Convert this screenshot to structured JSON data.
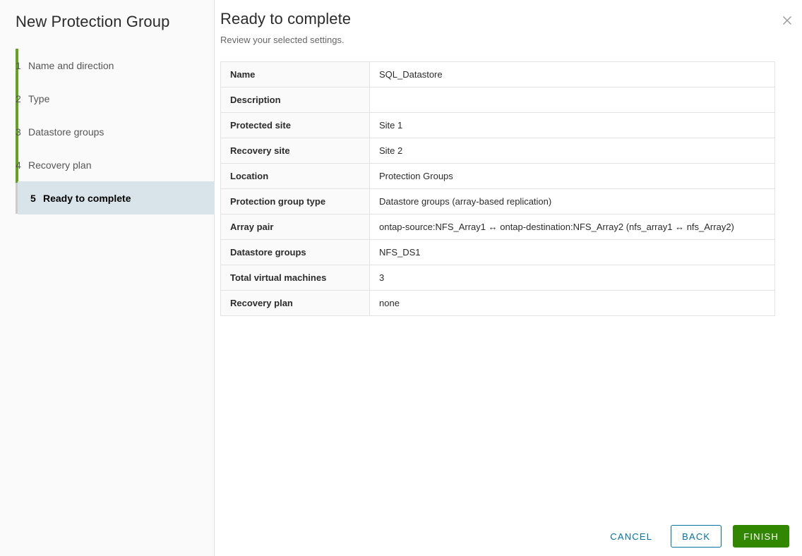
{
  "wizard": {
    "title": "New Protection Group",
    "steps": [
      {
        "number": "1",
        "label": "Name and direction"
      },
      {
        "number": "2",
        "label": "Type"
      },
      {
        "number": "3",
        "label": "Datastore groups"
      },
      {
        "number": "4",
        "label": "Recovery plan"
      },
      {
        "number": "5",
        "label": "Ready to complete"
      }
    ],
    "selected_step_index": 4
  },
  "content": {
    "title": "Ready to complete",
    "subtitle": "Review your selected settings.",
    "close_icon": "close-icon"
  },
  "summary": {
    "rows": [
      {
        "key": "Name",
        "value": "SQL_Datastore"
      },
      {
        "key": "Description",
        "value": ""
      },
      {
        "key": "Protected site",
        "value": "Site 1"
      },
      {
        "key": "Recovery site",
        "value": "Site 2"
      },
      {
        "key": "Location",
        "value": "Protection Groups"
      },
      {
        "key": "Protection group type",
        "value": "Datastore groups (array-based replication)"
      },
      {
        "key": "Array pair",
        "value": "ontap-source:NFS_Array1 ↔ ontap-destination:NFS_Array2 (nfs_array1 ↔ nfs_Array2)"
      },
      {
        "key": "Datastore groups",
        "value": "NFS_DS1"
      },
      {
        "key": "Total virtual machines",
        "value": "3"
      },
      {
        "key": "Recovery plan",
        "value": "none"
      }
    ]
  },
  "footer": {
    "cancel_label": "Cancel",
    "back_label": "Back",
    "finish_label": "Finish"
  },
  "colors": {
    "progress_green": "#62a420",
    "progress_gray": "#cccccc",
    "selected_step_bg": "#d9e4ea",
    "link_blue": "#0072a3",
    "finish_green": "#318700",
    "sidebar_bg": "#fafafa",
    "table_border": "#e3e3e3"
  }
}
